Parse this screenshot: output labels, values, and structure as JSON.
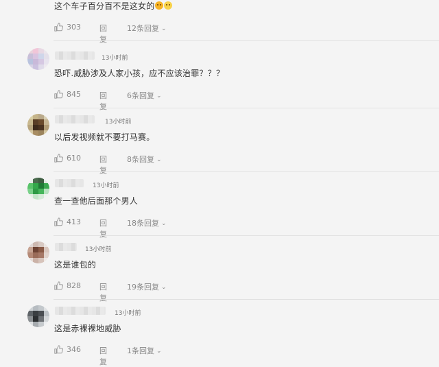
{
  "comments": [
    {
      "time": "",
      "text": "这个车子百分百不是这女的",
      "likes": "303",
      "reply_label": "回复",
      "replies_label": "12条回复",
      "emojis": [
        "laughing-emoji",
        "smiling-emoji"
      ]
    },
    {
      "time": "13小时前",
      "text": "恐吓.威胁涉及人家小孩，应不应该治罪？？？",
      "likes": "845",
      "reply_label": "回复",
      "replies_label": "6条回复"
    },
    {
      "time": "13小时前",
      "text": "以后发视频就不要打马赛。",
      "likes": "610",
      "reply_label": "回复",
      "replies_label": "8条回复"
    },
    {
      "time": "13小时前",
      "text": "查一查他后面那个男人",
      "likes": "413",
      "reply_label": "回复",
      "replies_label": "18条回复"
    },
    {
      "time": "13小时前",
      "text": "这是谁包的",
      "likes": "828",
      "reply_label": "回复",
      "replies_label": "19条回复"
    },
    {
      "time": "13小时前",
      "text": "这是赤裸裸地威胁",
      "likes": "346",
      "reply_label": "回复",
      "replies_label": "1条回复"
    }
  ],
  "colors": {
    "background": "#f4f4f4",
    "text": "#333333",
    "meta": "#888888",
    "divider": "#e1e1e1"
  }
}
